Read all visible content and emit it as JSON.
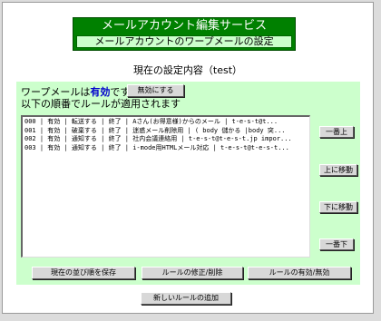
{
  "title": {
    "main": "メールアカウント編集サービス",
    "sub": "メールアカウントのワープメールの設定"
  },
  "heading": "現在の設定内容（test）",
  "status": {
    "prefix": "ワープメールは",
    "value": "有効",
    "suffix": "です",
    "toggle_label": "無効にする",
    "note": "以下の順番でルールが適用されます"
  },
  "rules": [
    "000 | 有効 | 転送する | 終了 | Aさん(お得意様)からのメール | t-e-s-t@t...",
    "001 | 有効 | 破棄する | 終了 | 迷惑メール削除用 | ( body 儲かる |body 突...",
    "002 | 有効 | 通知する | 終了 | 社内会議連絡用 | t-e-s-t@t-e-s-t.jp impor...",
    "003 | 有効 | 通知する | 終了 | i-mode用HTMLメール対応 | t-e-s-t@t-e-s-t..."
  ],
  "side_buttons": {
    "top": "一番上",
    "up": "上に移動",
    "down": "下に移動",
    "bottom": "一番下"
  },
  "actions": {
    "save_order": "現在の並び順を保存",
    "edit_delete": "ルールの修正/削除",
    "toggle_rule": "ルールの有効/無効",
    "add_rule": "新しいルールの追加"
  },
  "colors": {
    "title_bg": "#008000",
    "subtitle_bg": "#ccffcc",
    "panel_bg": "#ccffcc",
    "status_value": "#0000cc"
  }
}
